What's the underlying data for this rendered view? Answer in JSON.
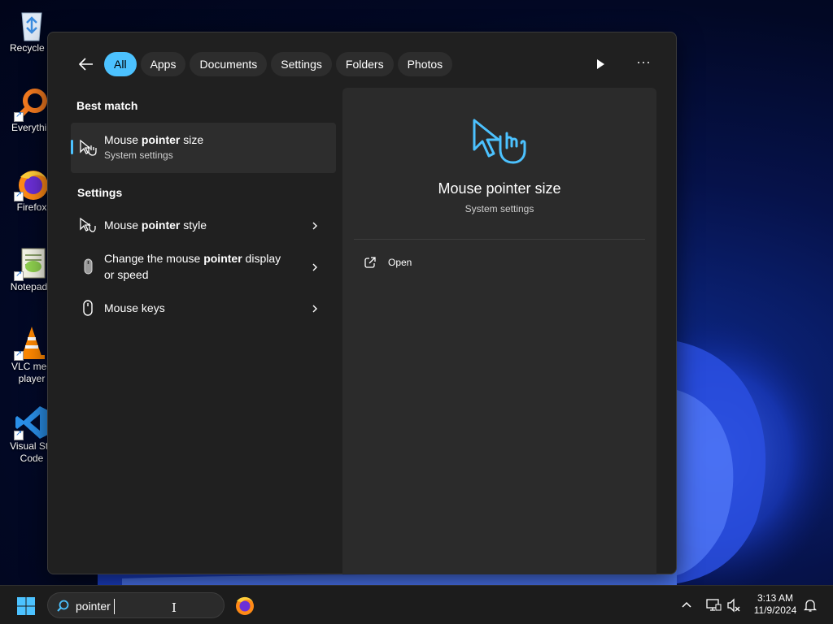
{
  "desktop": {
    "icons": [
      {
        "label": "Recycle B",
        "name": "recycle-bin-icon"
      },
      {
        "label": "Everythin",
        "name": "everything-search-icon"
      },
      {
        "label": "Firefox",
        "name": "firefox-icon"
      },
      {
        "label": "Notepad+",
        "name": "notepad-plus-plus-icon"
      },
      {
        "label": "VLC med player",
        "name": "vlc-icon"
      },
      {
        "label": "Visual Stu Code",
        "name": "vscode-icon"
      }
    ]
  },
  "search_panel": {
    "filters": [
      "All",
      "Apps",
      "Documents",
      "Settings",
      "Folders",
      "Photos"
    ],
    "active_filter": "All",
    "best_match_heading": "Best match",
    "best_match": {
      "title_pre": "Mouse ",
      "title_bold": "pointer",
      "title_post": " size",
      "subtitle": "System settings",
      "icon": "mouse-pointer-size-icon"
    },
    "settings_heading": "Settings",
    "settings_results": [
      {
        "line1_pre": "Mouse ",
        "line1_bold": "pointer",
        "line1_post": " style",
        "line2": "",
        "icon": "mouse-pointer-style-icon"
      },
      {
        "line1_pre": "Change the mouse ",
        "line1_bold": "pointer",
        "line1_post": " display",
        "line2": "or speed",
        "icon": "mouse-icon"
      },
      {
        "line1_pre": "Mouse keys",
        "line1_bold": "",
        "line1_post": "",
        "line2": "",
        "icon": "mouse-outline-icon"
      }
    ],
    "preview": {
      "title": "Mouse pointer size",
      "subtitle": "System settings",
      "open_label": "Open"
    }
  },
  "taskbar": {
    "search_value": "pointer",
    "time": "3:13 AM",
    "date": "11/9/2024"
  },
  "colors": {
    "accent": "#4cc2ff",
    "panel_bg": "#202020",
    "preview_bg": "#2b2b2b",
    "taskbar_bg": "#1c1c1c"
  }
}
